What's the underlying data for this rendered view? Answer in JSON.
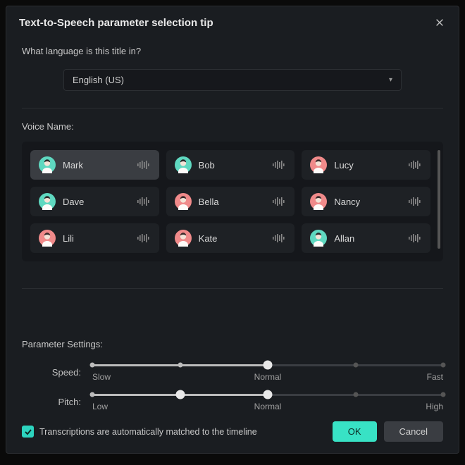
{
  "title": "Text-to-Speech parameter selection tip",
  "language": {
    "question": "What language is this title in?",
    "selected": "English (US)"
  },
  "voices": {
    "label": "Voice Name:",
    "items": [
      {
        "name": "Mark",
        "color": "teal",
        "selected": true
      },
      {
        "name": "Bob",
        "color": "teal",
        "selected": false
      },
      {
        "name": "Lucy",
        "color": "pink",
        "selected": false
      },
      {
        "name": "Dave",
        "color": "teal",
        "selected": false
      },
      {
        "name": "Bella",
        "color": "pink",
        "selected": false
      },
      {
        "name": "Nancy",
        "color": "pink",
        "selected": false
      },
      {
        "name": "Lili",
        "color": "pink",
        "selected": false
      },
      {
        "name": "Kate",
        "color": "pink",
        "selected": false
      },
      {
        "name": "Allan",
        "color": "teal",
        "selected": false
      }
    ]
  },
  "params": {
    "label": "Parameter Settings:",
    "speed": {
      "label": "Speed:",
      "low": "Slow",
      "mid": "Normal",
      "high": "Fast",
      "value": 50
    },
    "pitch": {
      "label": "Pitch:",
      "low": "Low",
      "mid": "Normal",
      "high": "High",
      "value": 50
    }
  },
  "footer": {
    "checkbox_label": "Transcriptions are automatically matched to the timeline",
    "checked": true,
    "ok": "OK",
    "cancel": "Cancel"
  },
  "colors": {
    "teal": "#5fd8c0",
    "pink": "#f08a8a",
    "accent": "#38e2c5"
  }
}
